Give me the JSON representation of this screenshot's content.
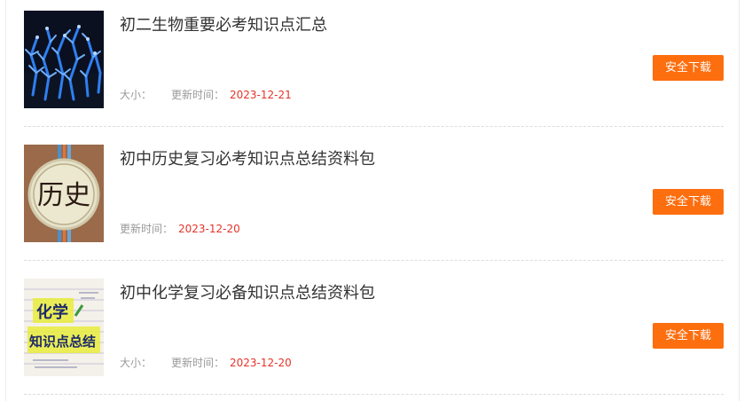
{
  "list": {
    "size_label": "大小：",
    "date_label": "更新时间：",
    "download_label": "安全下载",
    "items": [
      {
        "title": "初二生物重要必考知识点汇总",
        "date": "2023-12-21",
        "thumbnail_icon": "blue-plant-photo-icon"
      },
      {
        "title": "初中历史复习必考知识点总结资料包",
        "date": "2023-12-20",
        "thumbnail_icon": "history-seal-icon",
        "thumbnail_text": "历史"
      },
      {
        "title": "初中化学复习必备知识点总结资料包",
        "date": "2023-12-20",
        "thumbnail_icon": "chemistry-notes-icon",
        "thumbnail_text_line1": "化学",
        "thumbnail_text_line2": "知识点总结"
      }
    ]
  }
}
